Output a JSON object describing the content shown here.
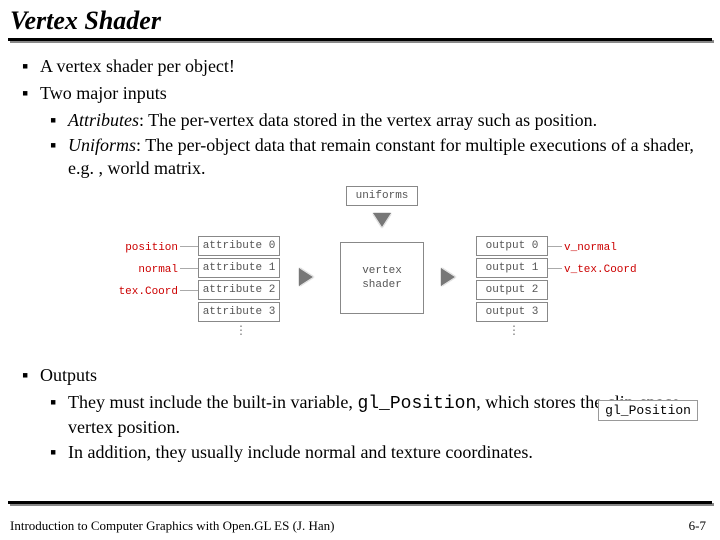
{
  "title": "Vertex Shader",
  "bullets": {
    "b1": "A vertex shader per object!",
    "b2": "Two major inputs",
    "b2a_label": "Attributes",
    "b2a_rest": ": The per-vertex data stored in the vertex array such as position.",
    "b2b_label": "Uniforms",
    "b2b_rest": ": The per-object data that remain constant for multiple executions of a shader, e.g. , world matrix.",
    "b3": "Outputs",
    "b3a_pre": "They must include the built-in variable, ",
    "b3a_code": "gl_Position",
    "b3a_post": ", which stores the clip-space vertex position.",
    "b3b": "In addition, they usually include normal and texture coordinates."
  },
  "diagram": {
    "uniforms": "uniforms",
    "inputs_red": [
      "position",
      "normal",
      "tex.Coord"
    ],
    "attrs": [
      "attribute 0",
      "attribute 1",
      "attribute 2",
      "attribute 3"
    ],
    "center": "vertex\nshader",
    "outputs": [
      "output 0",
      "output 1",
      "output 2",
      "output 3"
    ],
    "outputs_red": [
      "v_normal",
      "v_tex.Coord"
    ],
    "callout": "gl_Position"
  },
  "footer": "Introduction to Computer Graphics with Open.GL ES (J. Han)",
  "page": "6-7",
  "glyph": {
    "square": "▪"
  }
}
